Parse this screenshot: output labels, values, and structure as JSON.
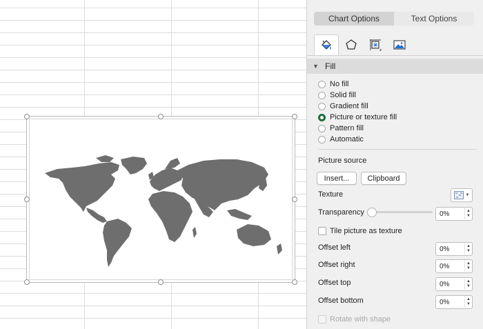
{
  "pane": {
    "tabs": [
      {
        "label": "Chart Options",
        "active": true
      },
      {
        "label": "Text Options",
        "active": false
      }
    ],
    "icon_tabs": [
      "fill-line-icon",
      "effects-pentagon-icon",
      "size-properties-icon",
      "picture-icon"
    ],
    "fill_section": {
      "title": "Fill",
      "options": [
        "No fill",
        "Solid fill",
        "Gradient fill",
        "Picture or texture fill",
        "Pattern fill",
        "Automatic"
      ],
      "selected": "Picture or texture fill"
    },
    "picture_source": {
      "label": "Picture source",
      "insert_label": "Insert...",
      "clipboard_label": "Clipboard"
    },
    "texture_label": "Texture",
    "transparency": {
      "label": "Transparency",
      "value": "0%",
      "slider_fraction": 0
    },
    "tile_label": "Tile picture as texture",
    "offsets": [
      {
        "label": "Offset left",
        "value": "0%"
      },
      {
        "label": "Offset right",
        "value": "0%"
      },
      {
        "label": "Offset top",
        "value": "0%"
      },
      {
        "label": "Offset bottom",
        "value": "0%"
      }
    ],
    "rotate_label": "Rotate with shape"
  },
  "colors": {
    "radio_selected": "#1e6b3c",
    "map_fill": "#6e6e6e",
    "pane_bg": "#f0f0f0",
    "grid": "#dcdcdc"
  }
}
